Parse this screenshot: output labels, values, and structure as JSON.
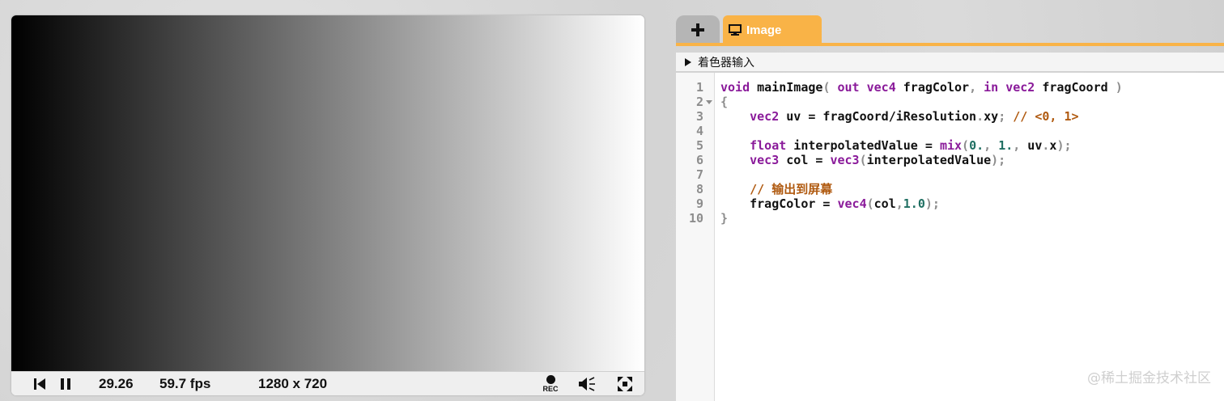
{
  "player": {
    "time": "29.26",
    "fps": "59.7 fps",
    "resolution": "1280 x 720",
    "rec_label": "REC"
  },
  "editor": {
    "add_tab_icon": "plus-icon",
    "image_tab": {
      "label": "Image",
      "icon": "monitor-icon"
    },
    "inputs_label": "着色器输入",
    "line_numbers": [
      "1",
      "2",
      "3",
      "4",
      "5",
      "6",
      "7",
      "8",
      "9",
      "10"
    ],
    "code": [
      [
        {
          "t": "void",
          "c": "kw"
        },
        {
          "t": " mainImage"
        },
        {
          "t": "(",
          "c": "pun"
        },
        {
          "t": " "
        },
        {
          "t": "out",
          "c": "kw"
        },
        {
          "t": " "
        },
        {
          "t": "vec4",
          "c": "ty"
        },
        {
          "t": " fragColor"
        },
        {
          "t": ",",
          "c": "pun"
        },
        {
          "t": " "
        },
        {
          "t": "in",
          "c": "kw"
        },
        {
          "t": " "
        },
        {
          "t": "vec2",
          "c": "ty"
        },
        {
          "t": " fragCoord "
        },
        {
          "t": ")",
          "c": "pun"
        }
      ],
      [
        {
          "t": "{",
          "c": "pun"
        }
      ],
      [
        {
          "t": "    "
        },
        {
          "t": "vec2",
          "c": "ty"
        },
        {
          "t": " uv = fragCoord/iResolution"
        },
        {
          "t": ".",
          "c": "pun"
        },
        {
          "t": "xy"
        },
        {
          "t": ";",
          "c": "pun"
        },
        {
          "t": " "
        },
        {
          "t": "// <0, 1>",
          "c": "cm"
        }
      ],
      [],
      [
        {
          "t": "    "
        },
        {
          "t": "float",
          "c": "ty"
        },
        {
          "t": " interpolatedValue = "
        },
        {
          "t": "mix",
          "c": "fn"
        },
        {
          "t": "(",
          "c": "pun"
        },
        {
          "t": "0.",
          "c": "num"
        },
        {
          "t": ",",
          "c": "pun"
        },
        {
          "t": " "
        },
        {
          "t": "1.",
          "c": "num"
        },
        {
          "t": ",",
          "c": "pun"
        },
        {
          "t": " uv"
        },
        {
          "t": ".",
          "c": "pun"
        },
        {
          "t": "x"
        },
        {
          "t": ");",
          "c": "pun"
        }
      ],
      [
        {
          "t": "    "
        },
        {
          "t": "vec3",
          "c": "ty"
        },
        {
          "t": " col = "
        },
        {
          "t": "vec3",
          "c": "fn"
        },
        {
          "t": "(",
          "c": "pun"
        },
        {
          "t": "interpolatedValue"
        },
        {
          "t": ");",
          "c": "pun"
        }
      ],
      [],
      [
        {
          "t": "    "
        },
        {
          "t": "// 输出到屏幕",
          "c": "cm"
        }
      ],
      [
        {
          "t": "    fragColor = "
        },
        {
          "t": "vec4",
          "c": "fn"
        },
        {
          "t": "(",
          "c": "pun"
        },
        {
          "t": "col"
        },
        {
          "t": ",",
          "c": "pun"
        },
        {
          "t": "1.0",
          "c": "num"
        },
        {
          "t": ");",
          "c": "pun"
        }
      ],
      [
        {
          "t": "}",
          "c": "pun"
        }
      ]
    ]
  },
  "watermark": "@稀土掘金技术社区",
  "colors": {
    "accent_orange": "#f9b347",
    "keyword_purple": "#8a1a9a",
    "number_green": "#1f6f62",
    "comment_orange": "#b05a10"
  }
}
